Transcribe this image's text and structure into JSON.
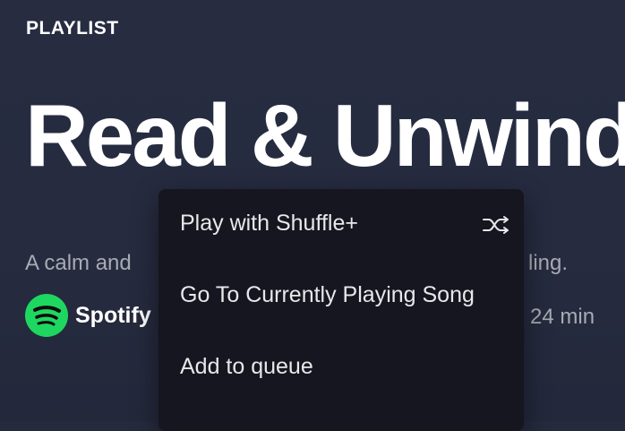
{
  "playlist": {
    "type_label": "PLAYLIST",
    "title": "Read & Unwind",
    "description_visible_start": "A calm and",
    "description_visible_end": "ling.",
    "owner": "Spotify",
    "duration": "24 min"
  },
  "context_menu": {
    "items": [
      {
        "label": "Play with Shuffle+",
        "icon": "shuffle-icon"
      },
      {
        "label": "Go To Currently Playing Song"
      },
      {
        "label": "Add to queue"
      }
    ]
  },
  "colors": {
    "background": "#252a3e",
    "menu_background": "#15161f",
    "spotify_green": "#1ed760",
    "muted_text": "#a9abb3"
  }
}
